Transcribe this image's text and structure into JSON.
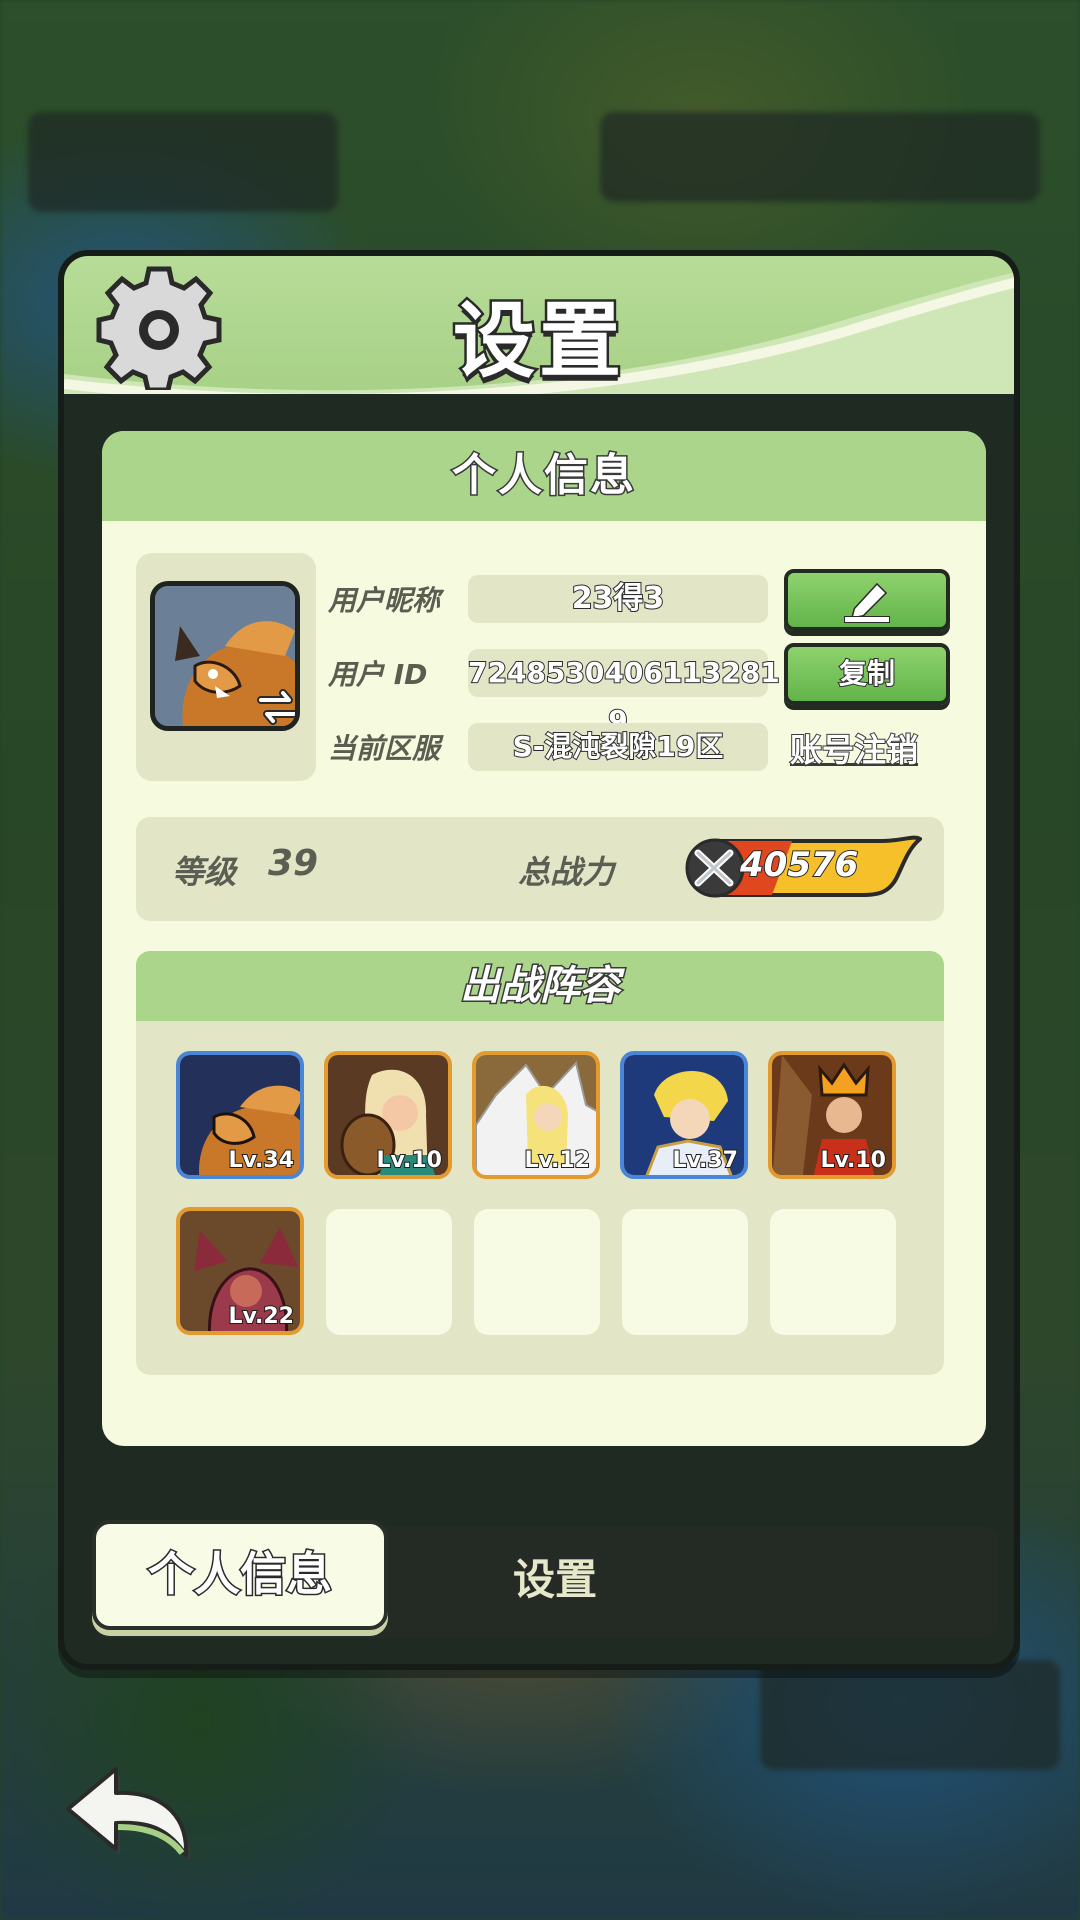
{
  "header": {
    "title": "设置"
  },
  "card": {
    "title": "个人信息",
    "nickname_label": "用户昵称",
    "nickname_value": "23得3",
    "id_label": "用户 ID",
    "id_value": "7248530406113281​9",
    "server_label": "当前区服",
    "server_value": "S-混沌裂隙19区",
    "copy_label": "复制",
    "logout_label": "账号注销"
  },
  "stats": {
    "level_label": "等级",
    "level_value": "39",
    "power_label": "总战力",
    "power_value": "40576"
  },
  "lineup": {
    "title": "出战阵容",
    "heroes": [
      {
        "level": "Lv.34"
      },
      {
        "level": "Lv.10"
      },
      {
        "level": "Lv.12"
      },
      {
        "level": "Lv.37"
      },
      {
        "level": "Lv.10"
      },
      {
        "level": "Lv.22"
      }
    ]
  },
  "tabs": {
    "profile": "个人信息",
    "settings": "设置"
  },
  "icons": [
    "gear-icon",
    "avatar-swap-icon",
    "edit-pen-icon",
    "power-swords-icon",
    "back-arrow-icon"
  ]
}
